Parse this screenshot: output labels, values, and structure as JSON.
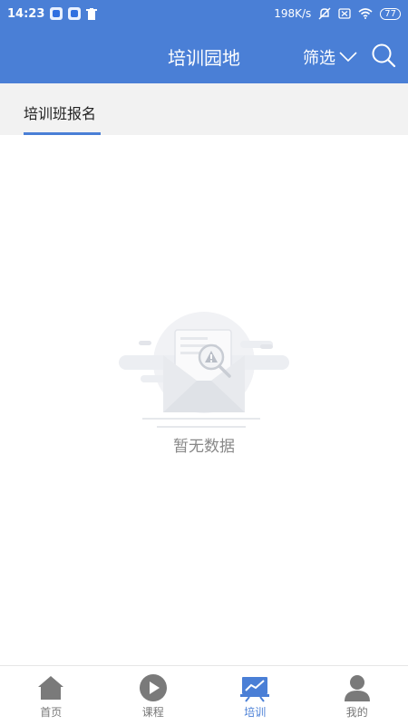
{
  "status": {
    "time": "14:23",
    "network": "198K/s",
    "battery": "77"
  },
  "header": {
    "title": "培训园地",
    "filter_label": "筛选"
  },
  "tabs": [
    {
      "label": "培训班报名",
      "active": true
    }
  ],
  "empty_state": {
    "text": "暂无数据"
  },
  "bottom_nav": [
    {
      "label": "首页",
      "icon": "home-icon",
      "active": false
    },
    {
      "label": "课程",
      "icon": "play-icon",
      "active": false
    },
    {
      "label": "培训",
      "icon": "training-icon",
      "active": true
    },
    {
      "label": "我的",
      "icon": "user-icon",
      "active": false
    }
  ],
  "colors": {
    "primary": "#4a7fd6",
    "inactive": "#777777",
    "tab_bg": "#f2f2f2"
  }
}
